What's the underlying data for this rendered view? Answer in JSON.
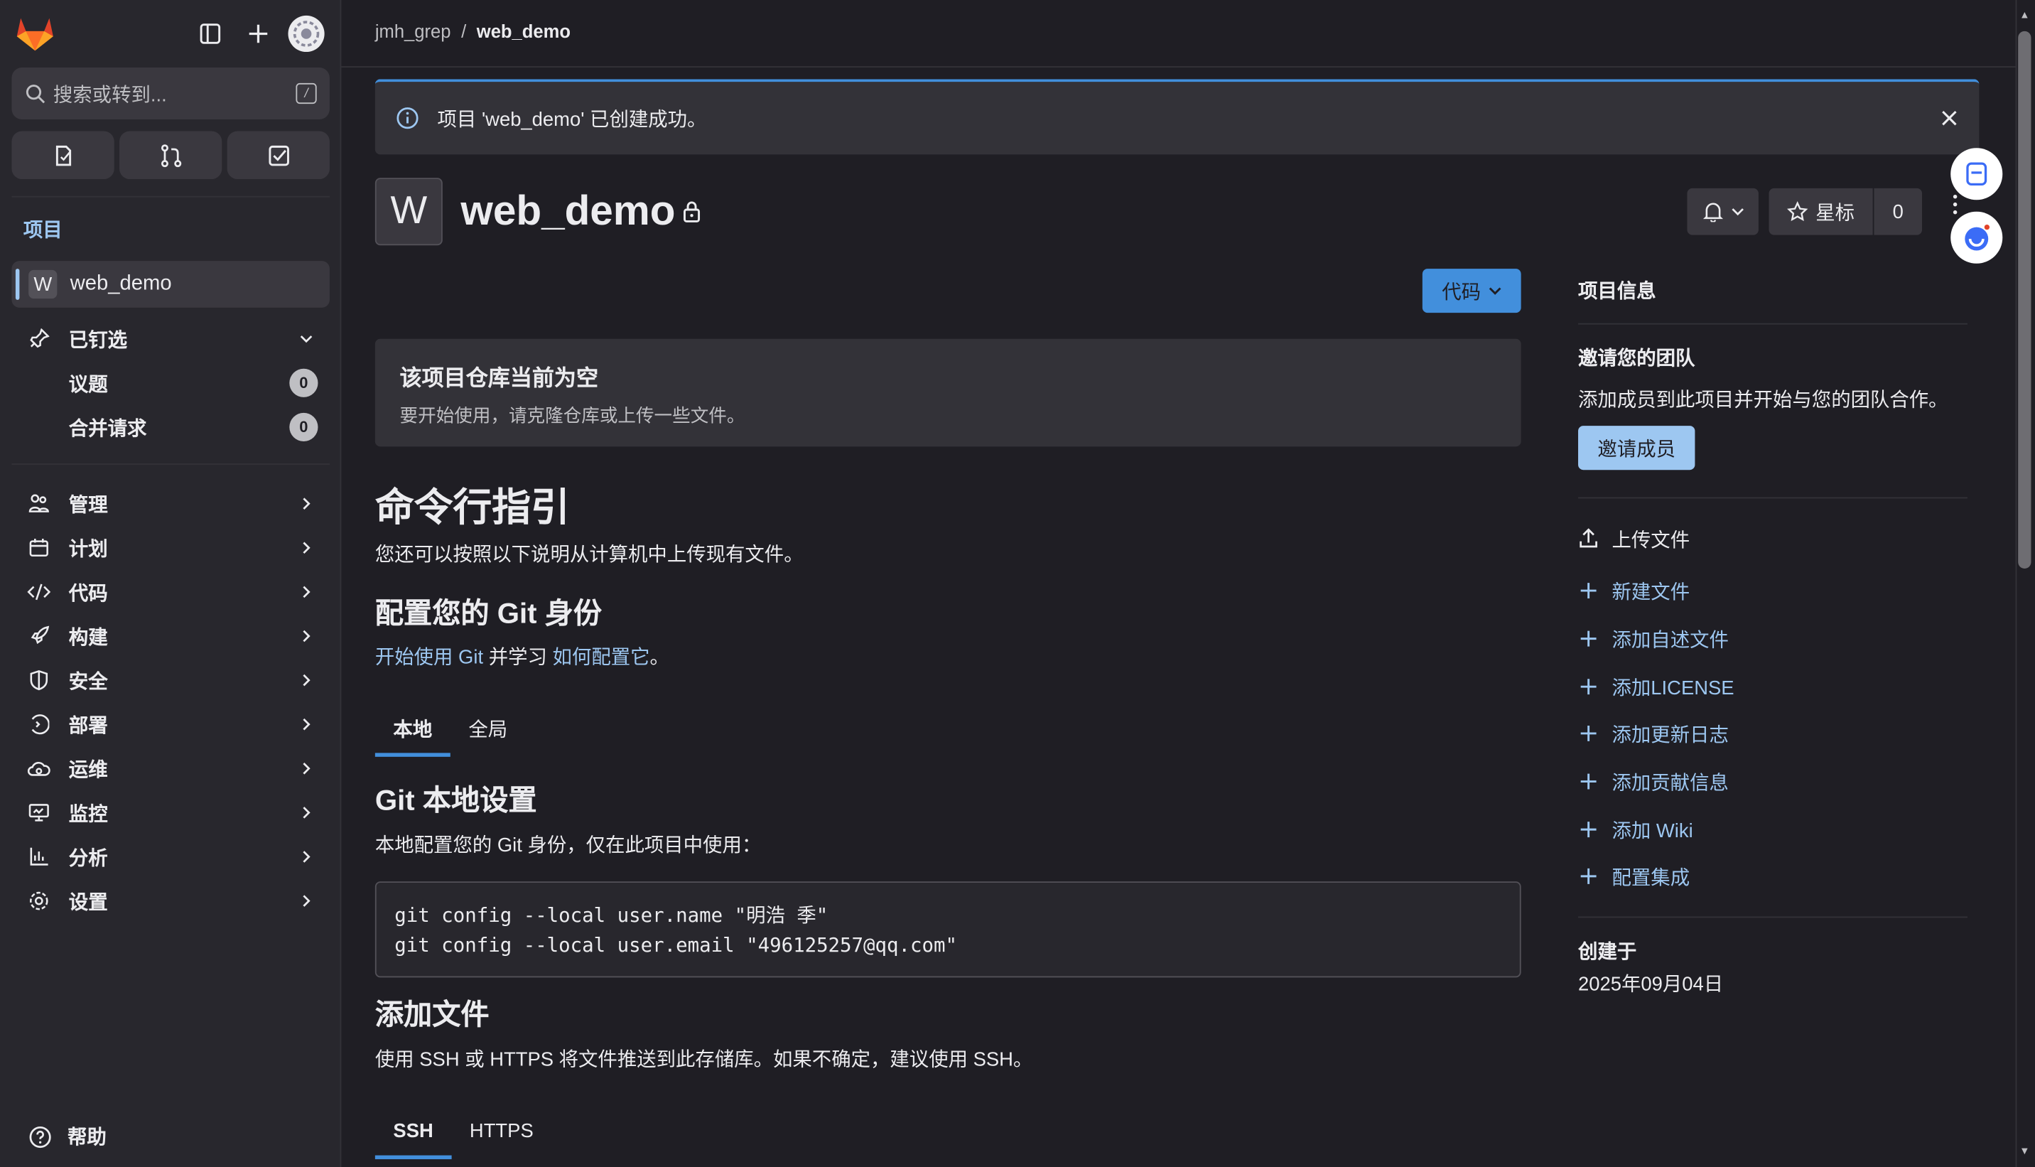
{
  "colors": {
    "accent": "#428fdc",
    "link": "#9dc7f1",
    "bg": "#1f1e24",
    "sidebar_bg": "#28272d"
  },
  "sidebar": {
    "search_placeholder": "搜索或转到...",
    "search_shortcut": "/",
    "section_heading": "项目",
    "project": {
      "avatar_letter": "W",
      "name": "web_demo"
    },
    "pinned": {
      "label": "已钉选",
      "items": [
        {
          "label": "议题",
          "count": "0"
        },
        {
          "label": "合并请求",
          "count": "0"
        }
      ]
    },
    "nav": [
      {
        "label": "管理",
        "icon": "manage-icon"
      },
      {
        "label": "计划",
        "icon": "plan-icon"
      },
      {
        "label": "代码",
        "icon": "code-icon"
      },
      {
        "label": "构建",
        "icon": "rocket-icon"
      },
      {
        "label": "安全",
        "icon": "shield-icon"
      },
      {
        "label": "部署",
        "icon": "deploy-icon"
      },
      {
        "label": "运维",
        "icon": "cloud-gear-icon"
      },
      {
        "label": "监控",
        "icon": "monitor-icon"
      },
      {
        "label": "分析",
        "icon": "chart-icon"
      },
      {
        "label": "设置",
        "icon": "gear-icon"
      }
    ],
    "help": "帮助"
  },
  "breadcrumb": {
    "parent": "jmh_grep",
    "sep": "/",
    "current": "web_demo"
  },
  "alert": {
    "text": "项目 'web_demo' 已创建成功。"
  },
  "project_header": {
    "avatar_letter": "W",
    "title": "web_demo",
    "star_label": "星标",
    "star_count": "0"
  },
  "code_button": "代码",
  "empty": {
    "title": "该项目仓库当前为空",
    "desc": "要开始使用，请克隆仓库或上传一些文件。"
  },
  "guide": {
    "title": "命令行指引",
    "intro": "您还可以按照以下说明从计算机中上传现有文件。",
    "identity_title": "配置您的 Git 身份",
    "identity_link1": "开始使用 Git",
    "identity_mid": " 并学习 ",
    "identity_link2": "如何配置它",
    "identity_end": "。",
    "tabs": [
      "本地",
      "全局"
    ],
    "local_title": "Git 本地设置",
    "local_desc": "本地配置您的 Git 身份，仅在此项目中使用：",
    "code": "git config --local user.name \"明浩 季\"\ngit config --local user.email \"496125257@qq.com\"",
    "add_files_title": "添加文件",
    "add_files_desc": "使用 SSH 或 HTTPS 将文件推送到此存储库。如果不确定，建议使用 SSH。",
    "proto_tabs": [
      "SSH",
      "HTTPS"
    ]
  },
  "right": {
    "info_title": "项目信息",
    "invite_title": "邀请您的团队",
    "invite_desc": "添加成员到此项目并开始与您的团队合作。",
    "invite_btn": "邀请成员",
    "upload": "上传文件",
    "actions": [
      "新建文件",
      "添加自述文件",
      "添加LICENSE",
      "添加更新日志",
      "添加贡献信息",
      "添加 Wiki",
      "配置集成"
    ],
    "created_label": "创建于",
    "created_date": "2025年09月04日"
  }
}
